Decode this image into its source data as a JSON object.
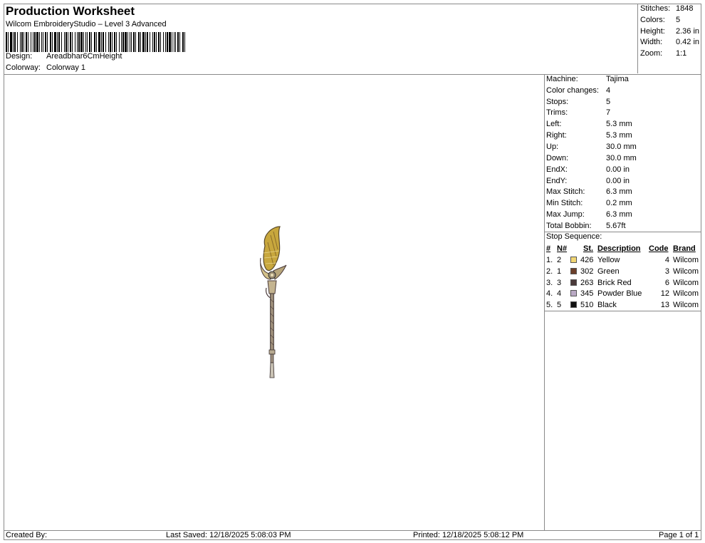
{
  "header": {
    "title": "Production Worksheet",
    "subtitle": "Wilcom EmbroideryStudio – Level 3 Advanced",
    "design_label": "Design:",
    "design_value": "Areadbhar6CmHeight",
    "colorway_label": "Colorway:",
    "colorway_value": "Colorway 1"
  },
  "stats": [
    {
      "label": "Stitches:",
      "value": "1848"
    },
    {
      "label": "Colors:",
      "value": "5"
    },
    {
      "label": "Height:",
      "value": "2.36 in"
    },
    {
      "label": "Width:",
      "value": "0.42 in"
    },
    {
      "label": "Zoom:",
      "value": "1:1"
    }
  ],
  "machine_info": [
    {
      "label": "Machine:",
      "value": "Tajima"
    },
    {
      "label": "Color changes:",
      "value": "4"
    },
    {
      "label": "Stops:",
      "value": "5"
    },
    {
      "label": "Trims:",
      "value": "7"
    },
    {
      "label": "Left:",
      "value": "5.3 mm"
    },
    {
      "label": "Right:",
      "value": "5.3 mm"
    },
    {
      "label": "Up:",
      "value": "30.0 mm"
    },
    {
      "label": "Down:",
      "value": "30.0 mm"
    },
    {
      "label": "EndX:",
      "value": "0.00 in"
    },
    {
      "label": "EndY:",
      "value": "0.00 in"
    },
    {
      "label": "Max Stitch:",
      "value": "6.3 mm"
    },
    {
      "label": "Min Stitch:",
      "value": "0.2 mm"
    },
    {
      "label": "Max Jump:",
      "value": "6.3 mm"
    },
    {
      "label": "Total Bobbin:",
      "value": "5.67ft"
    }
  ],
  "stop_sequence": {
    "title": "Stop Sequence:",
    "headers": {
      "num": "#",
      "n": "N#",
      "st": "St.",
      "description": "Description",
      "code": "Code",
      "brand": "Brand"
    },
    "rows": [
      {
        "num": "1.",
        "n": "2",
        "st": "426",
        "description": "Yellow",
        "code": "4",
        "brand": "Wilcom",
        "color": "#f2d774"
      },
      {
        "num": "2.",
        "n": "1",
        "st": "302",
        "description": "Green",
        "code": "3",
        "brand": "Wilcom",
        "color": "#6b3f2a"
      },
      {
        "num": "3.",
        "n": "3",
        "st": "263",
        "description": "Brick Red",
        "code": "6",
        "brand": "Wilcom",
        "color": "#4a3a3a"
      },
      {
        "num": "4.",
        "n": "4",
        "st": "345",
        "description": "Powder Blue",
        "code": "12",
        "brand": "Wilcom",
        "color": "#b9a9c4"
      },
      {
        "num": "5.",
        "n": "5",
        "st": "510",
        "description": "Black",
        "code": "13",
        "brand": "Wilcom",
        "color": "#111111"
      }
    ]
  },
  "footer": {
    "created_by": "Created By:",
    "last_saved": "Last Saved: 12/18/2025 5:08:03 PM",
    "printed": "Printed: 12/18/2025 5:08:12 PM",
    "page": "Page 1 of 1"
  }
}
